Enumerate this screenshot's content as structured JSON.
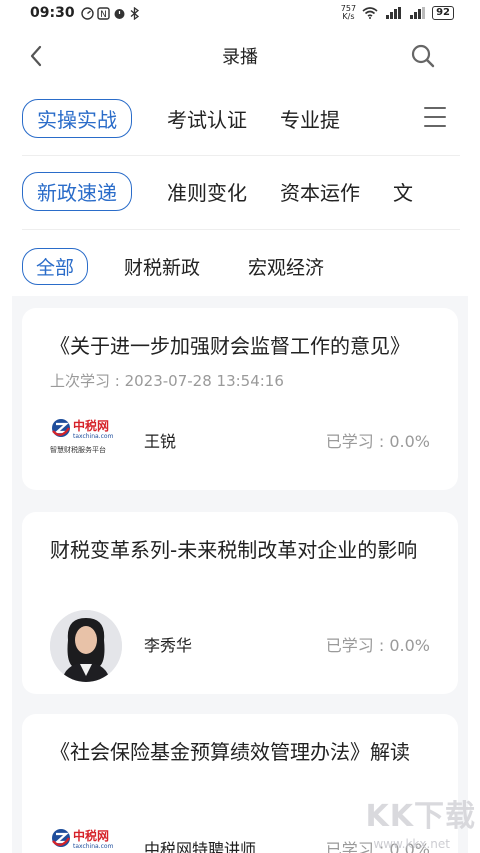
{
  "status": {
    "time": "09:30",
    "net_speed_value": "757",
    "net_speed_unit": "K/s",
    "battery": "92"
  },
  "header": {
    "title": "录播"
  },
  "tabs_row1": [
    {
      "label": "实操实战",
      "active": true
    },
    {
      "label": "考试认证",
      "active": false
    },
    {
      "label": "专业提",
      "active": false
    }
  ],
  "tabs_row2": [
    {
      "label": "新政速递",
      "active": true
    },
    {
      "label": "准则变化",
      "active": false
    },
    {
      "label": "资本运作",
      "active": false
    },
    {
      "label": "文",
      "active": false
    }
  ],
  "tabs_row3": [
    {
      "label": "全部",
      "active": true
    },
    {
      "label": "财税新政",
      "active": false
    },
    {
      "label": "宏观经济",
      "active": false
    }
  ],
  "courses": [
    {
      "title": "《关于进一步加强财会监督工作的意见》",
      "last_study": "上次学习 : 2023-07-28 13:54:16",
      "teacher": "王锐",
      "progress": "已学习 : 0.0%",
      "logo_name": "中税网",
      "logo_domain": "taxchina.com",
      "logo_slogan": "智慧财税服务平台"
    },
    {
      "title": "财税变革系列-未来税制改革对企业的影响",
      "last_study": "",
      "teacher": "李秀华",
      "progress": "已学习 : 0.0%"
    },
    {
      "title": "《社会保险基金预算绩效管理办法》解读",
      "last_study": "",
      "teacher": "中税网特聘讲师",
      "progress": "已学习 : 0.0%",
      "logo_name": "中税网",
      "logo_domain": "taxchina.com"
    }
  ],
  "watermark": {
    "text": "KK下载",
    "sub": "www.kkx.net"
  },
  "colors": {
    "accent": "#2a6cc9",
    "logo_red": "#d6232a",
    "logo_blue": "#1f4e9c",
    "muted": "#9a9a9a",
    "list_bg": "#f5f6f8"
  }
}
